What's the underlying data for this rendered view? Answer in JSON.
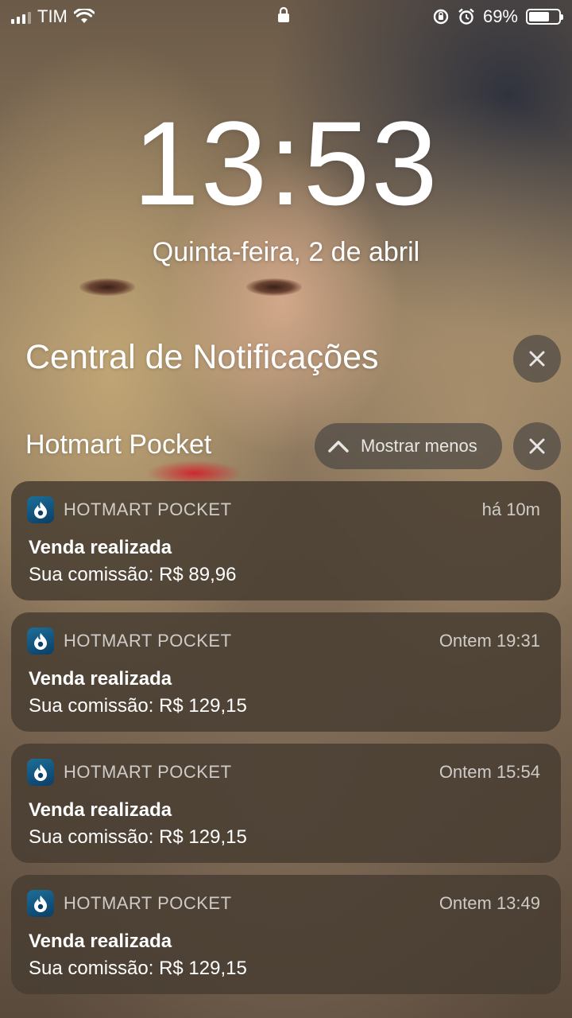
{
  "status_bar": {
    "carrier": "TIM",
    "battery_percent": "69%",
    "battery_level": 0.69
  },
  "lock_screen": {
    "time": "13:53",
    "date": "Quinta-feira, 2 de abril"
  },
  "notification_center": {
    "title": "Central de Notificações",
    "group": {
      "title": "Hotmart Pocket",
      "show_less_label": "Mostrar menos"
    },
    "notifications": [
      {
        "app": "HOTMART POCKET",
        "time": "há 10m",
        "title": "Venda realizada",
        "body": "Sua comissão: R$ 89,96"
      },
      {
        "app": "HOTMART POCKET",
        "time": "Ontem 19:31",
        "title": "Venda realizada",
        "body": "Sua comissão: R$ 129,15"
      },
      {
        "app": "HOTMART POCKET",
        "time": "Ontem 15:54",
        "title": "Venda realizada",
        "body": "Sua comissão: R$ 129,15"
      },
      {
        "app": "HOTMART POCKET",
        "time": "Ontem 13:49",
        "title": "Venda realizada",
        "body": "Sua comissão: R$ 129,15"
      }
    ]
  },
  "icons": {
    "app_icon": "hotmart-flame-icon",
    "close": "close-icon",
    "chevron": "chevron-up-icon"
  },
  "colors": {
    "app_icon_bg": "#0b3e66",
    "card_bg": "#483e32"
  }
}
